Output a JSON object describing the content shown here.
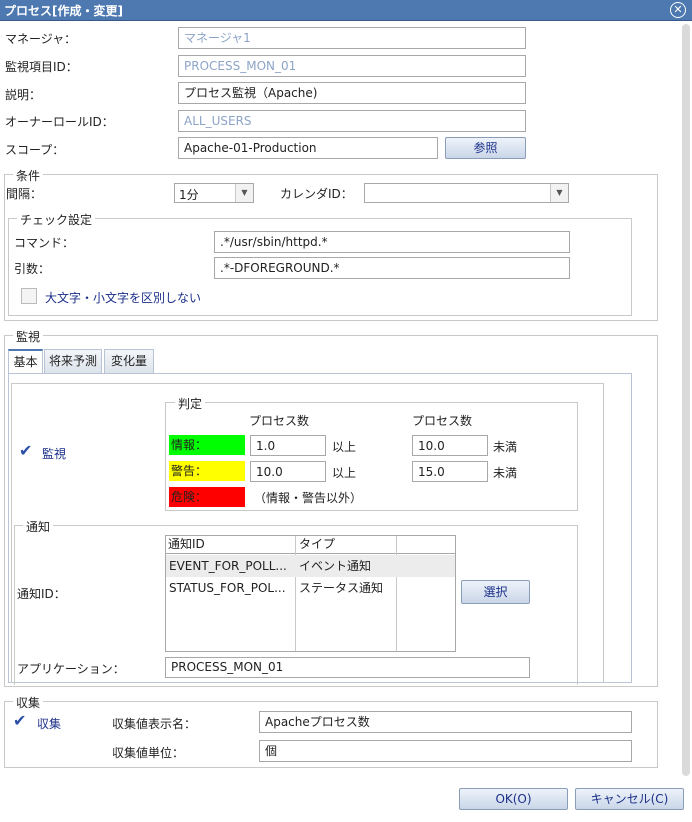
{
  "window": {
    "title": "プロセス[作成・変更]"
  },
  "general": {
    "manager_label": "マネージャ：",
    "manager_value": "マネージャ1",
    "monitor_id_label": "監視項目ID：",
    "monitor_id_value": "PROCESS_MON_01",
    "description_label": "説明：",
    "description_value": "プロセス監視（Apache)",
    "owner_role_label": "オーナーロールID：",
    "owner_role_value": "ALL_USERS",
    "scope_label": "スコープ：",
    "scope_value": "Apache-01-Production",
    "browse_button": "参照"
  },
  "conditions": {
    "legend": "条件",
    "interval_label": "間隔：",
    "interval_value": "1分",
    "calendar_label": "カレンダID：",
    "calendar_value": "",
    "check_settings": {
      "legend": "チェック設定",
      "command_label": "コマンド：",
      "command_value": ".*/usr/sbin/httpd.*",
      "args_label": "引数：",
      "args_value": ".*-DFOREGROUND.*",
      "case_insensitive_label": "大文字・小文字を区別しない",
      "case_insensitive_checked": false
    }
  },
  "monitor": {
    "legend": "監視",
    "tabs": [
      "基本",
      "将来予測",
      "変化量"
    ],
    "active_tab": 0,
    "monitor_label": "監視",
    "monitor_checked": true,
    "judgment": {
      "legend": "判定",
      "col1_header": "プロセス数",
      "col2_header": "プロセス数",
      "info_label": "情報：",
      "info_color": "#00ff00",
      "info_min": "1.0",
      "info_min_suffix": "以上",
      "info_max": "10.0",
      "info_max_suffix": "未満",
      "warning_label": "警告：",
      "warning_color": "#ffff00",
      "warning_min": "10.0",
      "warning_min_suffix": "以上",
      "warning_max": "15.0",
      "warning_max_suffix": "未満",
      "critical_label": "危険：",
      "critical_color": "#ff0000",
      "critical_note": "（情報・警告以外）"
    },
    "notification": {
      "legend": "通知",
      "notify_id_label": "通知ID：",
      "columns": [
        "通知ID",
        "タイプ"
      ],
      "rows": [
        {
          "id": "EVENT_FOR_POLL...",
          "type": "イベント通知"
        },
        {
          "id": "STATUS_FOR_POL...",
          "type": "ステータス通知"
        }
      ],
      "select_button": "選択",
      "application_label": "アプリケーション：",
      "application_value": "PROCESS_MON_01"
    }
  },
  "collection": {
    "legend": "収集",
    "collect_label": "収集",
    "collect_checked": true,
    "display_name_label": "収集値表示名：",
    "display_name_value": "Apacheプロセス数",
    "unit_label": "収集値単位：",
    "unit_value": "個"
  },
  "footer": {
    "ok_button": "OK(O)",
    "cancel_button": "キャンセル(C)"
  }
}
